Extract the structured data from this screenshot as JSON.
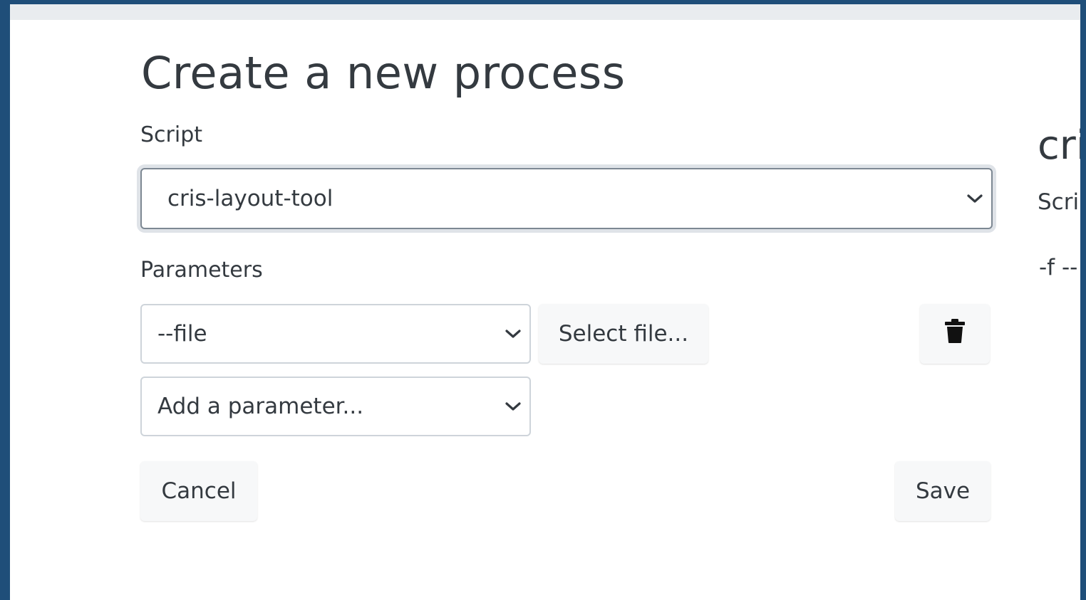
{
  "header": {
    "title": "Create a new process"
  },
  "form": {
    "script_label": "Script",
    "script_value": "cris-layout-tool",
    "parameters_label": "Parameters",
    "parameters": [
      {
        "name": "--file",
        "action_label": "Select file..."
      }
    ],
    "add_parameter_placeholder": "Add a parameter...",
    "cancel_label": "Cancel",
    "save_label": "Save"
  },
  "side_panel": {
    "title_fragment": "cri",
    "script_label_fragment": "Scri",
    "params_fragment": "-f --"
  },
  "icons": {
    "delete": "trash-icon",
    "select_chevron": "chevron-down-icon"
  },
  "colors": {
    "frame_border": "#1f4e79",
    "text": "#343a40",
    "input_border": "#ced4da",
    "button_bg": "#f7f8f9"
  }
}
